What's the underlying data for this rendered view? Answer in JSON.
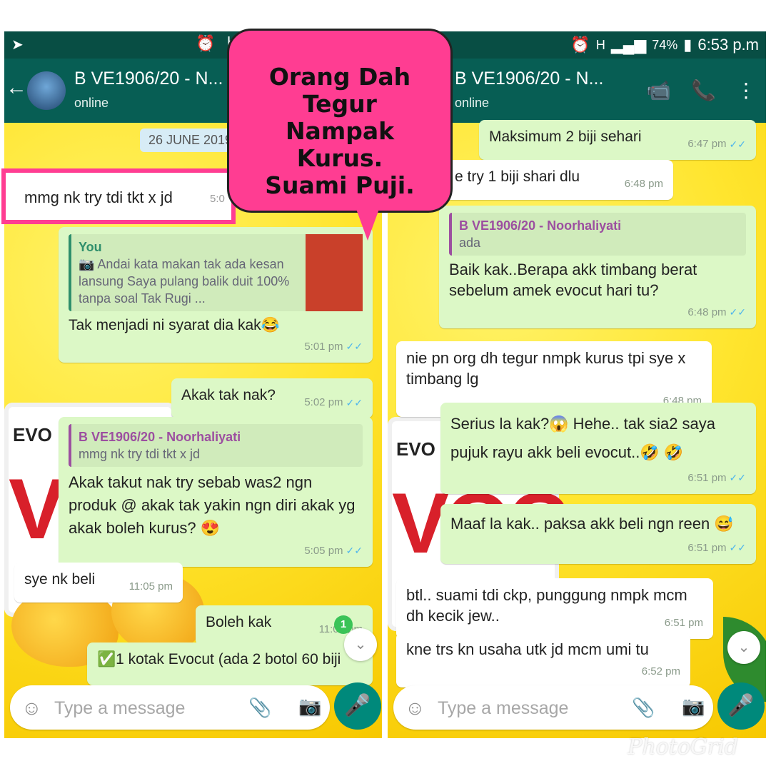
{
  "left": {
    "status": {
      "partial": "H"
    },
    "header": {
      "back_icon": "arrow-back-icon",
      "name": "B VE1906/20 - N...",
      "sub": "online"
    },
    "date_chip": "26 JUNE 2019",
    "messages": [
      {
        "quote_name": "You",
        "quote_text": "Andai kata makan tak ada kesan lansung Saya pulang balik duit 100% tanpa soal Tak Rugi ...",
        "text": "Tak menjadi ni syarat dia kak😂",
        "time": "5:01 pm"
      },
      {
        "text": "Akak tak nak?",
        "time": "5:02 pm"
      },
      {
        "quote_name": "B VE1906/20 - Noorhaliyati",
        "quote_text": "mmg nk try tdi tkt x jd",
        "text": "Akak takut nak try sebab was2 ngn produk @ akak tak yakin ngn diri akak yg akak boleh kurus? 😍",
        "time": "5:05 pm"
      },
      {
        "text": "sye nk beli",
        "time": "11:05 pm"
      },
      {
        "text": "Boleh kak",
        "time": "11:07 pm"
      },
      {
        "text": "✅1 kotak Evocut (ada 2 botol 60 biji"
      }
    ],
    "badge": "1",
    "composer": {
      "placeholder": "Type a message"
    }
  },
  "right": {
    "status": {
      "network": "H",
      "battery": "74%",
      "clock": "6:53 p.m"
    },
    "header": {
      "name": "B VE1906/20 - N...",
      "sub": "online"
    },
    "messages": [
      {
        "text": "Maksimum 2 biji sehari",
        "time": "6:47 pm"
      },
      {
        "text": "e try 1 biji shari dlu",
        "time": "6:48 pm"
      },
      {
        "quote_name": "B VE1906/20 - Noorhaliyati",
        "quote_text": "ada",
        "text": "Baik kak..Berapa akk timbang berat sebelum amek evocut hari tu?",
        "time": "6:48 pm"
      },
      {
        "text": "nie pn org dh tegur nmpk kurus tpi sye x timbang lg",
        "time": "6:48 pm"
      },
      {
        "text": "Serius la kak?😱 Hehe.. tak sia2 saya pujuk rayu akk beli evocut..🤣 🤣",
        "time": "6:51 pm"
      },
      {
        "text": "Maaf la kak.. paksa akk beli ngn reen 😅",
        "time": "6:51 pm"
      },
      {
        "text": "btl.. suami tdi ckp, punggung nmpk mcm dh kecik jew..",
        "time": "6:51 pm"
      },
      {
        "text": "kne trs kn usaha utk jd mcm umi tu",
        "time": "6:52 pm"
      }
    ],
    "composer": {
      "placeholder": "Type a message"
    }
  },
  "highlight": {
    "text": "mmg nk try tdi tkt x jd",
    "time": "5:0"
  },
  "callout": {
    "lines": [
      "Orang Dah",
      "Tegur",
      "Nampak",
      "Kurus.",
      "Suami Puji."
    ]
  },
  "background": {
    "brand": "EVO",
    "product": "VOC"
  },
  "watermark": "PhotoGrid",
  "colors": {
    "header": "#075e54",
    "outgoing": "#dcf8c6",
    "incoming": "#ffffff",
    "callout": "#ff3d92",
    "background": "#ffe033"
  }
}
